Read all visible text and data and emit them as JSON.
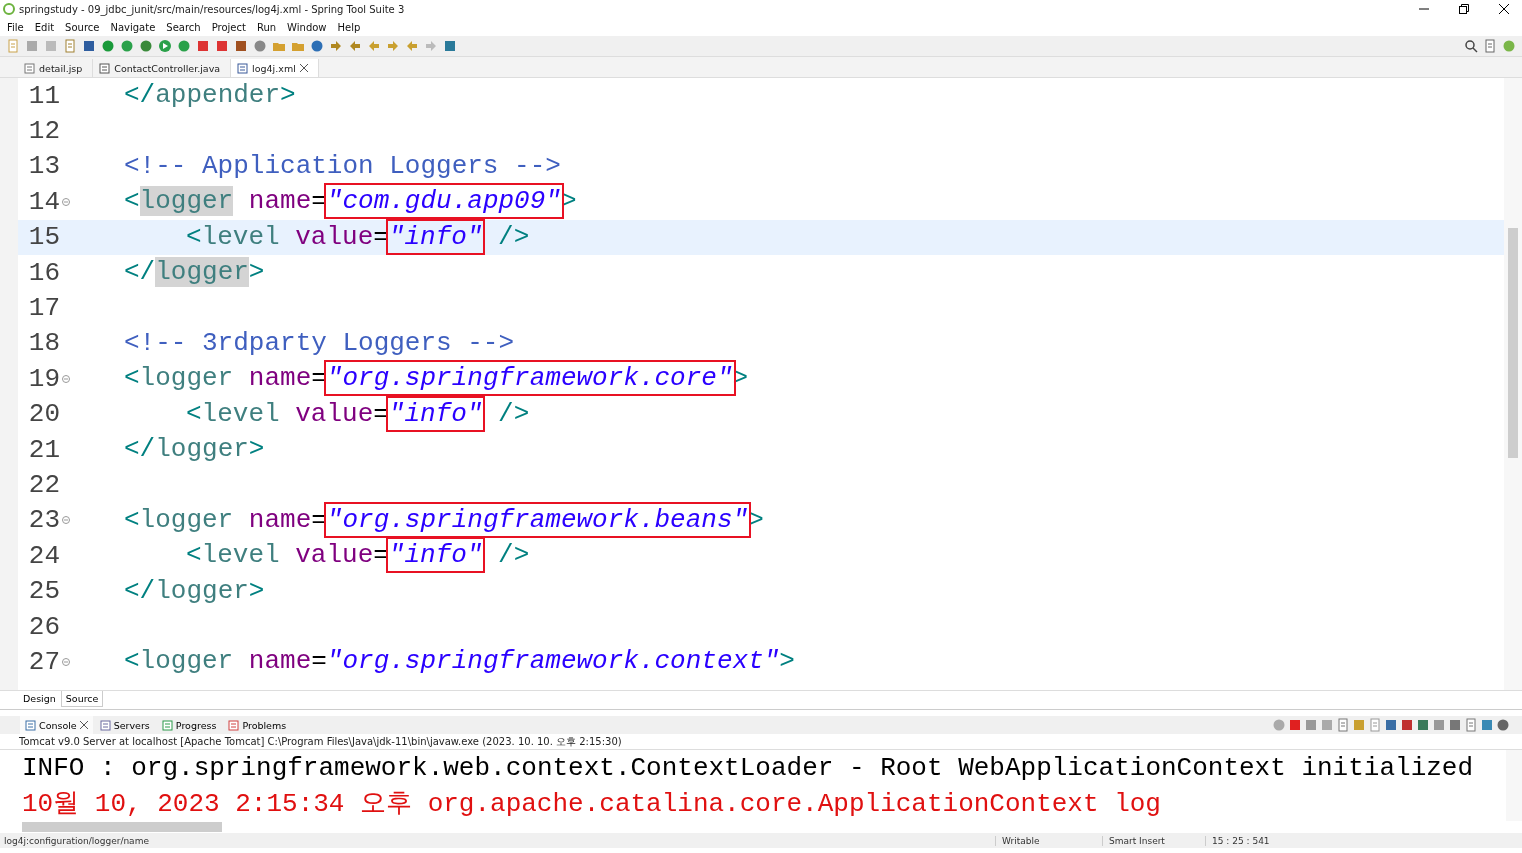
{
  "window": {
    "title": "springstudy - 09_jdbc_junit/src/main/resources/log4j.xml - Spring Tool Suite 3"
  },
  "menu": [
    "File",
    "Edit",
    "Source",
    "Navigate",
    "Search",
    "Project",
    "Run",
    "Window",
    "Help"
  ],
  "editor_tabs": [
    {
      "label": "detail.jsp",
      "kind": "jsp",
      "selected": false
    },
    {
      "label": "ContactController.java",
      "kind": "java",
      "selected": false
    },
    {
      "label": "log4j.xml",
      "kind": "xml",
      "selected": true
    }
  ],
  "code_lines": [
    {
      "number": "11",
      "current": false,
      "foldable": false,
      "tokens": [
        {
          "text": "</",
          "kind": "punct"
        },
        {
          "text": "appender",
          "kind": "tag"
        },
        {
          "text": ">",
          "kind": "punct"
        }
      ]
    },
    {
      "number": "12",
      "current": false,
      "foldable": false
    },
    {
      "number": "13",
      "current": false,
      "foldable": false,
      "tokens": [
        {
          "text": "<!-- Application Loggers -->",
          "kind": "comment"
        }
      ]
    },
    {
      "number": "14",
      "current": false,
      "foldable": true,
      "tokens": [
        {
          "text": "<",
          "kind": "punct"
        },
        {
          "text": "logger",
          "kind": "tag-occurrence"
        },
        {
          "text": " name",
          "kind": "attr"
        },
        {
          "text": "=",
          "kind": "plain"
        },
        {
          "text": "\"com.gdu.app09\"",
          "kind": "string-boxed"
        },
        {
          "text": ">",
          "kind": "punct"
        }
      ],
      "children": [
        {
          "number": "15",
          "current": true,
          "foldable": false,
          "tokens": [
            {
              "text": "<",
              "kind": "punct"
            },
            {
              "text": "level",
              "kind": "tag"
            },
            {
              "text": " value",
              "kind": "attr"
            },
            {
              "text": "=",
              "kind": "plain"
            },
            {
              "text": "\"info\"",
              "kind": "string-boxed"
            },
            {
              "text": " />",
              "kind": "punct"
            }
          ]
        }
      ]
    },
    {
      "number": "16",
      "current": false,
      "foldable": false,
      "tokens": [
        {
          "text": "</",
          "kind": "punct"
        },
        {
          "text": "logger",
          "kind": "tag-occurrence"
        },
        {
          "text": ">",
          "kind": "punct"
        }
      ]
    },
    {
      "number": "17",
      "current": false,
      "foldable": false
    },
    {
      "number": "18",
      "current": false,
      "foldable": false,
      "tokens": [
        {
          "text": "<!-- 3rdparty Loggers -->",
          "kind": "comment"
        }
      ]
    },
    {
      "number": "19",
      "current": false,
      "foldable": true,
      "tokens": [
        {
          "text": "<",
          "kind": "punct"
        },
        {
          "text": "logger",
          "kind": "tag"
        },
        {
          "text": " name",
          "kind": "attr"
        },
        {
          "text": "=",
          "kind": "plain"
        },
        {
          "text": "\"org.springframework.core\"",
          "kind": "string-boxed"
        },
        {
          "text": ">",
          "kind": "punct"
        }
      ],
      "children": [
        {
          "number": "20",
          "current": false,
          "foldable": false,
          "tokens": [
            {
              "text": "<",
              "kind": "punct"
            },
            {
              "text": "level",
              "kind": "tag"
            },
            {
              "text": " value",
              "kind": "attr"
            },
            {
              "text": "=",
              "kind": "plain"
            },
            {
              "text": "\"info\"",
              "kind": "string-boxed"
            },
            {
              "text": " />",
              "kind": "punct"
            }
          ]
        }
      ]
    },
    {
      "number": "21",
      "current": false,
      "foldable": false,
      "tokens": [
        {
          "text": "</",
          "kind": "punct"
        },
        {
          "text": "logger",
          "kind": "tag"
        },
        {
          "text": ">",
          "kind": "punct"
        }
      ]
    },
    {
      "number": "22",
      "current": false,
      "foldable": false
    },
    {
      "number": "23",
      "current": false,
      "foldable": true,
      "tokens": [
        {
          "text": "<",
          "kind": "punct"
        },
        {
          "text": "logger",
          "kind": "tag"
        },
        {
          "text": " name",
          "kind": "attr"
        },
        {
          "text": "=",
          "kind": "plain"
        },
        {
          "text": "\"org.springframework.beans\"",
          "kind": "string-boxed"
        },
        {
          "text": ">",
          "kind": "punct"
        }
      ],
      "children": [
        {
          "number": "24",
          "current": false,
          "foldable": false,
          "tokens": [
            {
              "text": "<",
              "kind": "punct"
            },
            {
              "text": "level",
              "kind": "tag"
            },
            {
              "text": " value",
              "kind": "attr"
            },
            {
              "text": "=",
              "kind": "plain"
            },
            {
              "text": "\"info\"",
              "kind": "string-boxed"
            },
            {
              "text": " />",
              "kind": "punct"
            }
          ]
        }
      ]
    },
    {
      "number": "25",
      "current": false,
      "foldable": false,
      "tokens": [
        {
          "text": "</",
          "kind": "punct"
        },
        {
          "text": "logger",
          "kind": "tag"
        },
        {
          "text": ">",
          "kind": "punct"
        }
      ]
    },
    {
      "number": "26",
      "current": false,
      "foldable": false
    },
    {
      "number": "27",
      "current": false,
      "foldable": true,
      "tokens": [
        {
          "text": "<",
          "kind": "punct"
        },
        {
          "text": "logger",
          "kind": "tag"
        },
        {
          "text": " name",
          "kind": "attr"
        },
        {
          "text": "=",
          "kind": "plain"
        },
        {
          "text": "\"org.springframework.context\"",
          "kind": "string"
        },
        {
          "text": ">",
          "kind": "punct"
        }
      ]
    }
  ],
  "view_tabs": [
    {
      "label": "Design",
      "selected": false
    },
    {
      "label": "Source",
      "selected": true
    }
  ],
  "console_tabs": [
    {
      "label": "Console",
      "kind": "console",
      "selected": true
    },
    {
      "label": "Servers",
      "kind": "servers",
      "selected": false
    },
    {
      "label": "Progress",
      "kind": "progress",
      "selected": false
    },
    {
      "label": "Problems",
      "kind": "problems",
      "selected": false
    }
  ],
  "console": {
    "process": "Tomcat v9.0 Server at localhost [Apache Tomcat] C:\\Program Files\\Java\\jdk-11\\bin\\javaw.exe  (2023. 10. 10. 오후 2:15:30)",
    "lines": [
      {
        "text": "INFO : org.springframework.web.context.ContextLoader - Root WebApplicationContext initialized",
        "kind": "out"
      },
      {
        "text": "10월 10, 2023 2:15:34 오후 org.apache.catalina.core.ApplicationContext log",
        "kind": "err"
      }
    ]
  },
  "status_bar": {
    "path": "log4j:configuration/logger/name",
    "mode": "Writable",
    "insert": "Smart Insert",
    "position": "15 : 25 : 541"
  }
}
